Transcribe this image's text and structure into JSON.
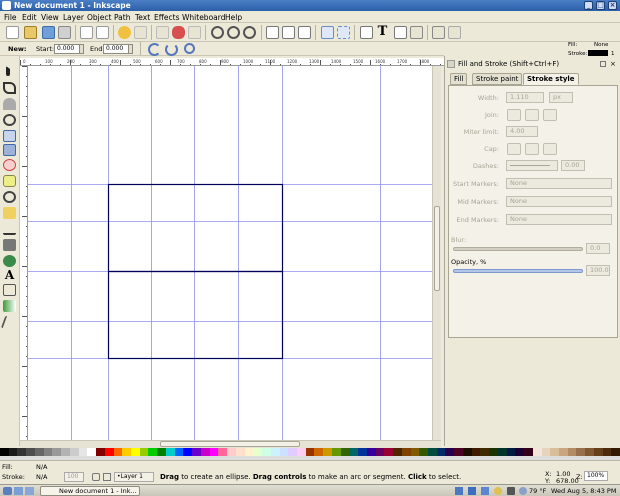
{
  "window": {
    "title": "New document 1 - Inkscape"
  },
  "menu": [
    "File",
    "Edit",
    "View",
    "Layer",
    "Object",
    "Path",
    "Text",
    "Effects",
    "Whiteboard",
    "Help"
  ],
  "ctrl": {
    "new_label": "New:",
    "start_label": "Start:",
    "start_value": "0.000",
    "end_label": "End:",
    "end_value": "0.000"
  },
  "style_indicator": {
    "fill_label": "Fill:",
    "fill_value": "None",
    "stroke_label": "Stroke:",
    "stroke_width": "1"
  },
  "dock": {
    "title": "Fill and Stroke (Shift+Ctrl+F)",
    "tabs": [
      "Fill",
      "Stroke paint",
      "Stroke style"
    ],
    "width_label": "Width:",
    "width_value": "1.110",
    "width_unit": "px",
    "join_label": "Join:",
    "miter_label": "Miter limit:",
    "miter_value": "4.00",
    "cap_label": "Cap:",
    "dashes_label": "Dashes:",
    "dashes_value": "0.00",
    "start_markers_label": "Start Markers:",
    "mid_markers_label": "Mid Markers:",
    "end_markers_label": "End Markers:",
    "marker_value": "None",
    "blur_label": "Blur:",
    "blur_value": "0.0",
    "opacity_label": "Opacity, %",
    "opacity_value": "100.0"
  },
  "status": {
    "fill_label": "Fill:",
    "fill_value": "N/A",
    "stroke_label": "Stroke:",
    "stroke_value": "N/A",
    "opacity_field": "100",
    "layer": "•Layer 1",
    "msg_bold1": "Drag",
    "msg_1": " to create an ellipse. ",
    "msg_bold2": "Drag controls",
    "msg_2": " to make an arc or segment. ",
    "msg_bold3": "Click",
    "msg_3": " to select.",
    "x_label": "X:",
    "x_value": "1.00",
    "y_label": "Y:",
    "y_value": "678.00",
    "zoom_label": "Z:",
    "zoom_value": "100%"
  },
  "taskbar": {
    "window_button": "New document 1 - Ink...",
    "temp": "79 °F",
    "clock": "Wed Aug 5,  8:43 PM"
  },
  "ruler_labels": [
    "0",
    "100",
    "200",
    "300",
    "400",
    "500",
    "600",
    "700",
    "800",
    "900",
    "1000",
    "1100",
    "1200",
    "1300",
    "1400",
    "1500",
    "1600",
    "1700",
    "1800"
  ],
  "colors": {
    "accent": "#2b5ea8",
    "guide": "#8f8fef",
    "page_border": "#00005c"
  }
}
